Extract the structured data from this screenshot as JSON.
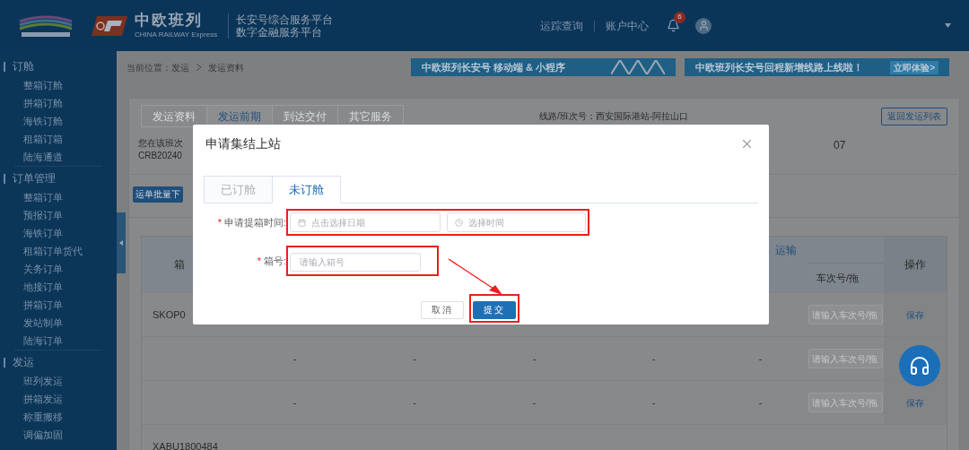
{
  "header": {
    "brand_name": "中欧班列",
    "brand_sub": "CHINA RAILWAY Express",
    "platform_lines": [
      "长安号综合服务平台",
      "数字金融服务平台"
    ],
    "nav": [
      "运踪查询",
      "账户中心"
    ],
    "notifications": "6"
  },
  "sidebar": {
    "sections": [
      {
        "title": "订舱",
        "items": [
          "整箱订舱",
          "拼箱订舱",
          "海铁订舱",
          "租箱订箱",
          "陆海通道"
        ]
      },
      {
        "title": "订单管理",
        "items": [
          "整箱订单",
          "预报订单",
          "海铁订单",
          "租箱订单货代",
          "关务订单",
          "地接订单",
          "拼箱订单",
          "发站制单",
          "陆海订单"
        ]
      },
      {
        "title": "发运",
        "items": [
          "班列发运",
          "拼箱发运",
          "称重搬移",
          "调偏加固"
        ]
      }
    ]
  },
  "breadcrumb": {
    "label": "当前位置：",
    "items": [
      "发运",
      "发运资料"
    ]
  },
  "banners": [
    {
      "text": "中欧班列长安号 移动端 & 小程序"
    },
    {
      "text": "中欧班列长安号回程新增线路上线啦！",
      "action": "立即体验>"
    }
  ],
  "page_tabs": [
    {
      "label": "发运资料",
      "selected": false
    },
    {
      "label": "发运前期",
      "selected": true
    },
    {
      "label": "到达交付",
      "selected": false
    },
    {
      "label": "其它服务",
      "selected": false
    }
  ],
  "route": "线路/班次号：西安国际港站-阿拉山口",
  "back_button": "返回发运列表",
  "notice": [
    "您在该班次",
    "CRB20240"
  ],
  "notice_tail": "07",
  "batch_button": "运单批量下",
  "table": {
    "first_column": "箱",
    "group_column": "运输",
    "sub_column": "车次号/拖",
    "action_column": "操作",
    "rows": [
      {
        "container": "SKOP0",
        "cells": [],
        "input_placeholder": "请输入车次号/拖",
        "action": "保存"
      },
      {
        "cells": [
          "-",
          "-",
          "-",
          "-",
          "-"
        ],
        "input_placeholder": "请输入车次号/拖"
      },
      {
        "cells": [
          "-",
          "-",
          "-",
          "-",
          "-"
        ],
        "input_placeholder": "请输入车次号/拖",
        "action": "保存"
      },
      {
        "container": "XABU1800484",
        "cells": []
      }
    ]
  },
  "dialog": {
    "title": "申请集结上站",
    "tabs": [
      {
        "label": "已订舱",
        "selected": false
      },
      {
        "label": "未订舱",
        "selected": true
      }
    ],
    "fields": [
      {
        "kind": "datetime",
        "mark": "*",
        "label": "申请提箱时间:",
        "placeholders": [
          "点击选择日期",
          "选择时间"
        ],
        "highlighted": true
      },
      {
        "kind": "text",
        "mark": "*",
        "label": "箱号:",
        "placeholder": "请输入箱号",
        "highlighted": true
      }
    ],
    "buttons": [
      {
        "kind": "default",
        "label": "取消",
        "highlighted": false
      },
      {
        "kind": "primary",
        "label": "提交",
        "highlighted": true
      }
    ]
  }
}
